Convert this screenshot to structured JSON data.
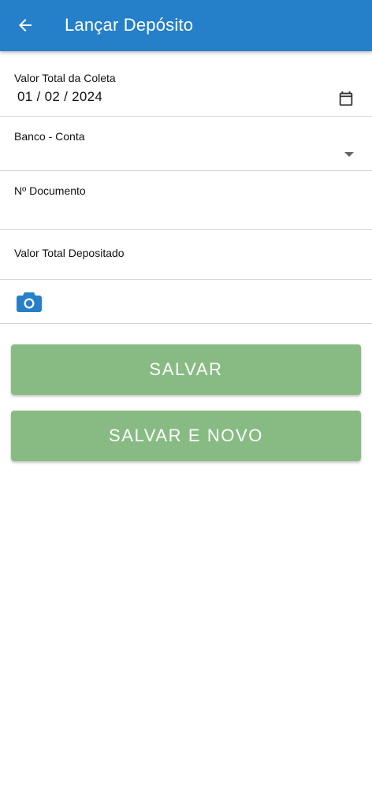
{
  "appbar": {
    "title": "Lançar Depósito",
    "back_icon": "arrow-left-icon",
    "background": "#2580c9"
  },
  "form": {
    "collection_total": {
      "label": "Valor Total da Coleta",
      "value": "01 / 02 / 2024",
      "icon": "calendar-icon"
    },
    "bank_account": {
      "label": "Banco - Conta",
      "value": "",
      "icon": "dropdown-arrow-icon"
    },
    "document_number": {
      "label": "Nº Documento",
      "value": ""
    },
    "total_deposited": {
      "label": "Valor Total Depositado",
      "value": ""
    },
    "photo": {
      "icon": "camera-icon",
      "color": "#2580c9"
    }
  },
  "actions": {
    "save_label": "SALVAR",
    "save_new_label": "SALVAR E NOVO",
    "button_color": "#88bb83"
  }
}
